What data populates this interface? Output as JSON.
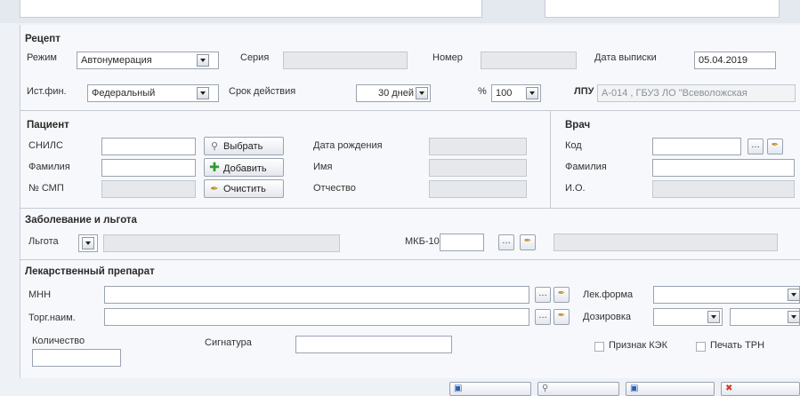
{
  "recipe": {
    "title": "Рецепт",
    "mode_label": "Режим",
    "mode_value": "Автонумерация",
    "series_label": "Серия",
    "number_label": "Номер",
    "issue_date_label": "Дата выписки",
    "issue_date_value": "05.04.2019",
    "fin_source_label": "Ист.фин.",
    "fin_source_value": "Федеральный",
    "validity_label": "Срок действия",
    "validity_value": "30 дней",
    "percent_label": "%",
    "percent_value": "100",
    "lpu_label": "ЛПУ",
    "lpu_value": "А-014 , ГБУЗ ЛО \"Всеволожская"
  },
  "patient": {
    "title": "Пациент",
    "snils_label": "СНИЛС",
    "surname_label": "Фамилия",
    "smp_label": "№ СМП",
    "select_button": "Выбрать",
    "add_button": "Добавить",
    "clear_button": "Очистить",
    "birth_date_label": "Дата рождения",
    "name_label": "Имя",
    "patronymic_label": "Отчество"
  },
  "doctor": {
    "title": "Врач",
    "code_label": "Код",
    "surname_label": "Фамилия",
    "initials_label": "И.О."
  },
  "disease": {
    "title": "Заболевание и льгота",
    "benefit_label": "Льгота",
    "mkb_label": "МКБ-10"
  },
  "drug": {
    "title": "Лекарственный препарат",
    "mnn_label": "МНН",
    "trade_label": "Торг.наим.",
    "form_label": "Лек.форма",
    "dosage_label": "Дозировка",
    "quantity_label": "Количество",
    "signature_label": "Сигнатура",
    "kek_label": "Признак КЭК",
    "print_trn_label": "Печать ТРН"
  },
  "icons": {
    "magnifier": "search-icon",
    "add": "plus-icon",
    "clear": "eraser-icon",
    "ellipsis": "ellipsis-icon",
    "dropdown": "chevron-down-icon"
  },
  "colors": {
    "panel_bg": "#f7f8fb",
    "outer_bg": "#eef1f6",
    "disabled_field": "#e6e8ec",
    "add_green": "#2e9a2e"
  }
}
